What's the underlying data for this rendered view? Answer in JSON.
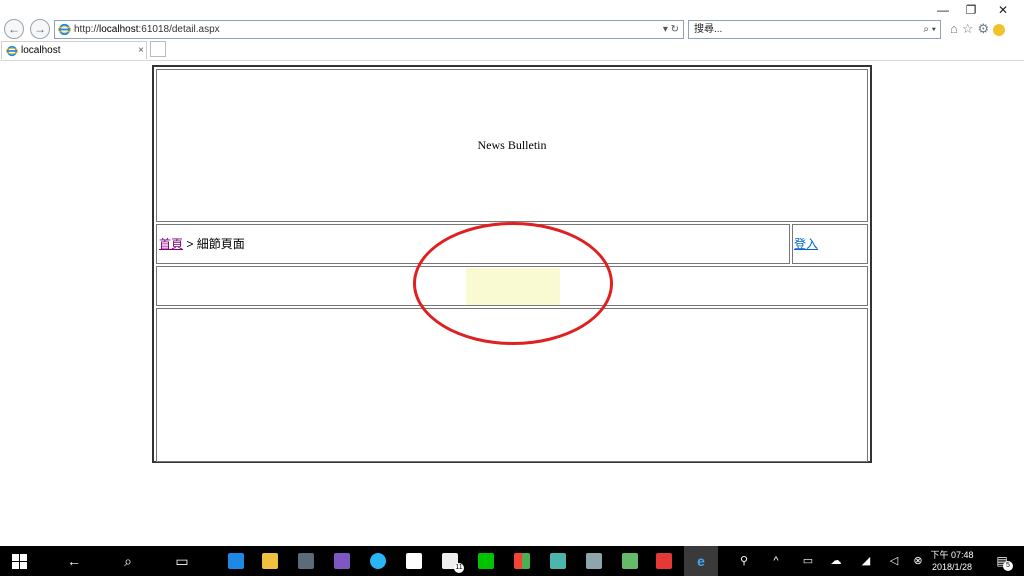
{
  "browser": {
    "url_prefix": "http://",
    "url_host": "localhost",
    "url_rest": ":61018/detail.aspx",
    "address_tools": "▾ ↻",
    "search_placeholder": "搜尋...",
    "search_tools": "⌕ ▾",
    "tab_title": "localhost",
    "tab_close": "×",
    "window_controls": {
      "minimize": "—",
      "restore": "❐",
      "close": "✕"
    }
  },
  "page": {
    "header_title": "News Bulletin",
    "breadcrumb_home": "首頁",
    "breadcrumb_separator": " > ",
    "breadcrumb_current": "細節頁面",
    "login_label": "登入"
  },
  "taskbar": {
    "clock_time": "下午 07:48",
    "clock_date": "2018/1/28",
    "mail_badge": "11",
    "notification_badge": "5"
  },
  "colors": {
    "annotation": "#e02020",
    "highlight_box": "#fafad2",
    "visited_link": "#800080",
    "link": "#0066cc"
  }
}
